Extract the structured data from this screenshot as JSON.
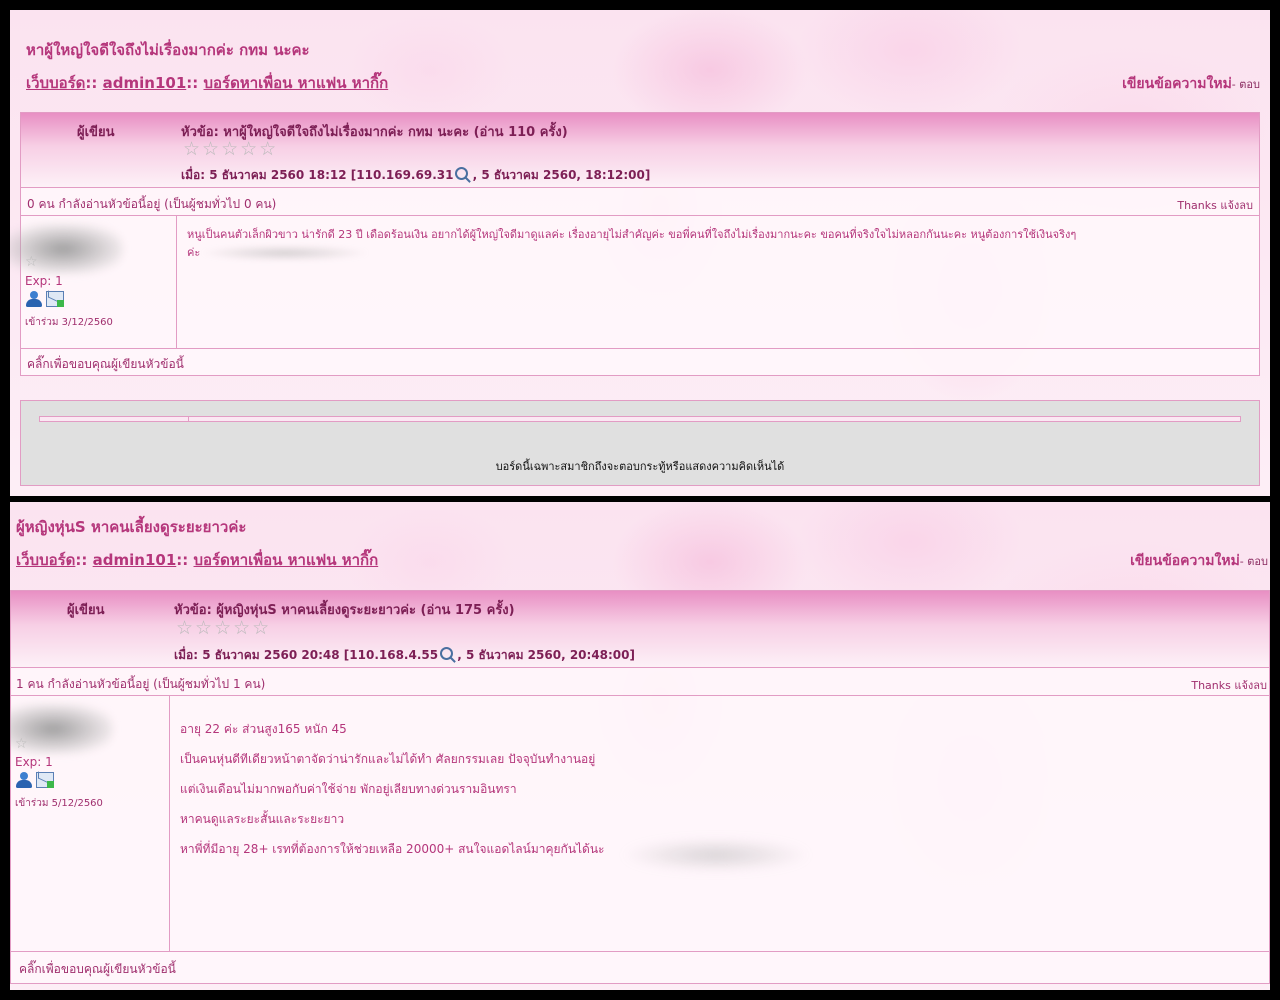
{
  "posts": [
    {
      "page_title": "หาผู้ใหญ่ใจดีใจถึงไม่เรื่องมากค่ะ กทม นะคะ",
      "breadcrumb": {
        "home": "เว็บบอร์ด",
        "sep1": "::",
        "user": "admin101",
        "sep2": "::",
        "board": "บอร์ดหาเพื่อน หาแฟน หากิ๊ก"
      },
      "new_post": "เขียนข้อความใหม่",
      "reply": "- ตอบ",
      "author_header": "ผู้เขียน",
      "subject": "หัวข้อ: หาผู้ใหญ่ใจดีใจถึงไม่เรื่องมากค่ะ กทม นะคะ  (อ่าน 110 ครั้ง)",
      "stars": "☆☆☆☆☆",
      "when_prefix": "เมื่อ: 5 ธันวาคม 2560 18:12 [110.169.69.31",
      "when_suffix": ", 5 ธันวาคม 2560, 18:12:00]",
      "viewers": "0 คน กำลังอ่านหัวข้อนี้อยู่ (เป็นผู้ชมทั่วไป 0 คน)",
      "thanks": "Thanks แจ้งลบ",
      "exp": "Exp: 1",
      "joined": "เข้าร่วม 3/12/2560",
      "body_lines": [
        "หนูเป็นคนตัวเล็กผิวขาว น่ารักดี 23 ปี เดือดร้อนเงิน อยากได้ผู้ใหญ่ใจดีมาดูแลค่ะ เรื่องอายุไม่สำคัญค่ะ ขอพี่คนที่ใจถึงไม่เรื่องมากนะคะ ขอคนที่จริงใจไม่หลอกกันนะคะ หนูต้องการใช้เงินจริงๆ",
        "ค่ะ"
      ],
      "footer": "คลิ๊กเพื่อขอบคุณผู้เขียนหัวข้อนี้",
      "members_only_notice": "บอร์ดนี้เฉพาะสมาชิกถึงจะตอบกระทู้หรือแสดงความคิดเห็นได้"
    },
    {
      "page_title": "ผู้หญิงหุ่นS หาคนเลี้ยงดูระยะยาวค่ะ",
      "breadcrumb": {
        "home": "เว็บบอร์ด",
        "sep1": "::",
        "user": "admin101",
        "sep2": "::",
        "board": "บอร์ดหาเพื่อน หาแฟน หากิ๊ก"
      },
      "new_post": "เขียนข้อความใหม่",
      "reply": "- ตอบ",
      "author_header": "ผู้เขียน",
      "subject": "หัวข้อ: ผู้หญิงหุ่นS หาคนเลี้ยงดูระยะยาวค่ะ  (อ่าน 175 ครั้ง)",
      "stars": "☆☆☆☆☆",
      "when_prefix": "เมื่อ: 5 ธันวาคม 2560 20:48 [110.168.4.55",
      "when_suffix": ", 5 ธันวาคม 2560, 20:48:00]",
      "viewers": "1 คน กำลังอ่านหัวข้อนี้อยู่ (เป็นผู้ชมทั่วไป 1 คน)",
      "thanks": "Thanks แจ้งลบ",
      "exp": "Exp: 1",
      "joined": "เข้าร่วม 5/12/2560",
      "body_paragraphs": [
        "อายุ 22 ค่ะ ส่วนสูง165 หนัก 45",
        "เป็นคนหุ่นดีทีเดียวหน้าตาจัดว่าน่ารักและไม่ได้ทำ ศัลยกรรมเลย ปัจจุบันทำงานอยู่",
        "แต่เงินเดือนไม่มากพอกับค่าใช้จ่าย พักอยู่เลียบทางด่วนรามอินทรา",
        "หาคนดูแลระยะสั้นและระยะยาว",
        "หาพี่ที่มีอายุ 28+ เรทที่ต้องการให้ช่วยเหลือ 20000+ สนใจแอดไลน์มาคุยกันได้นะ"
      ],
      "footer": "คลิ๊กเพื่อขอบคุณผู้เขียนหัวข้อนี้"
    }
  ],
  "colors": {
    "accent": "#b5367b",
    "header_dark": "#7d1f55",
    "border": "#e29cc4",
    "background": "#fbe8f3"
  },
  "icons": [
    "search-icon",
    "user-profile-icon",
    "send-message-icon"
  ]
}
